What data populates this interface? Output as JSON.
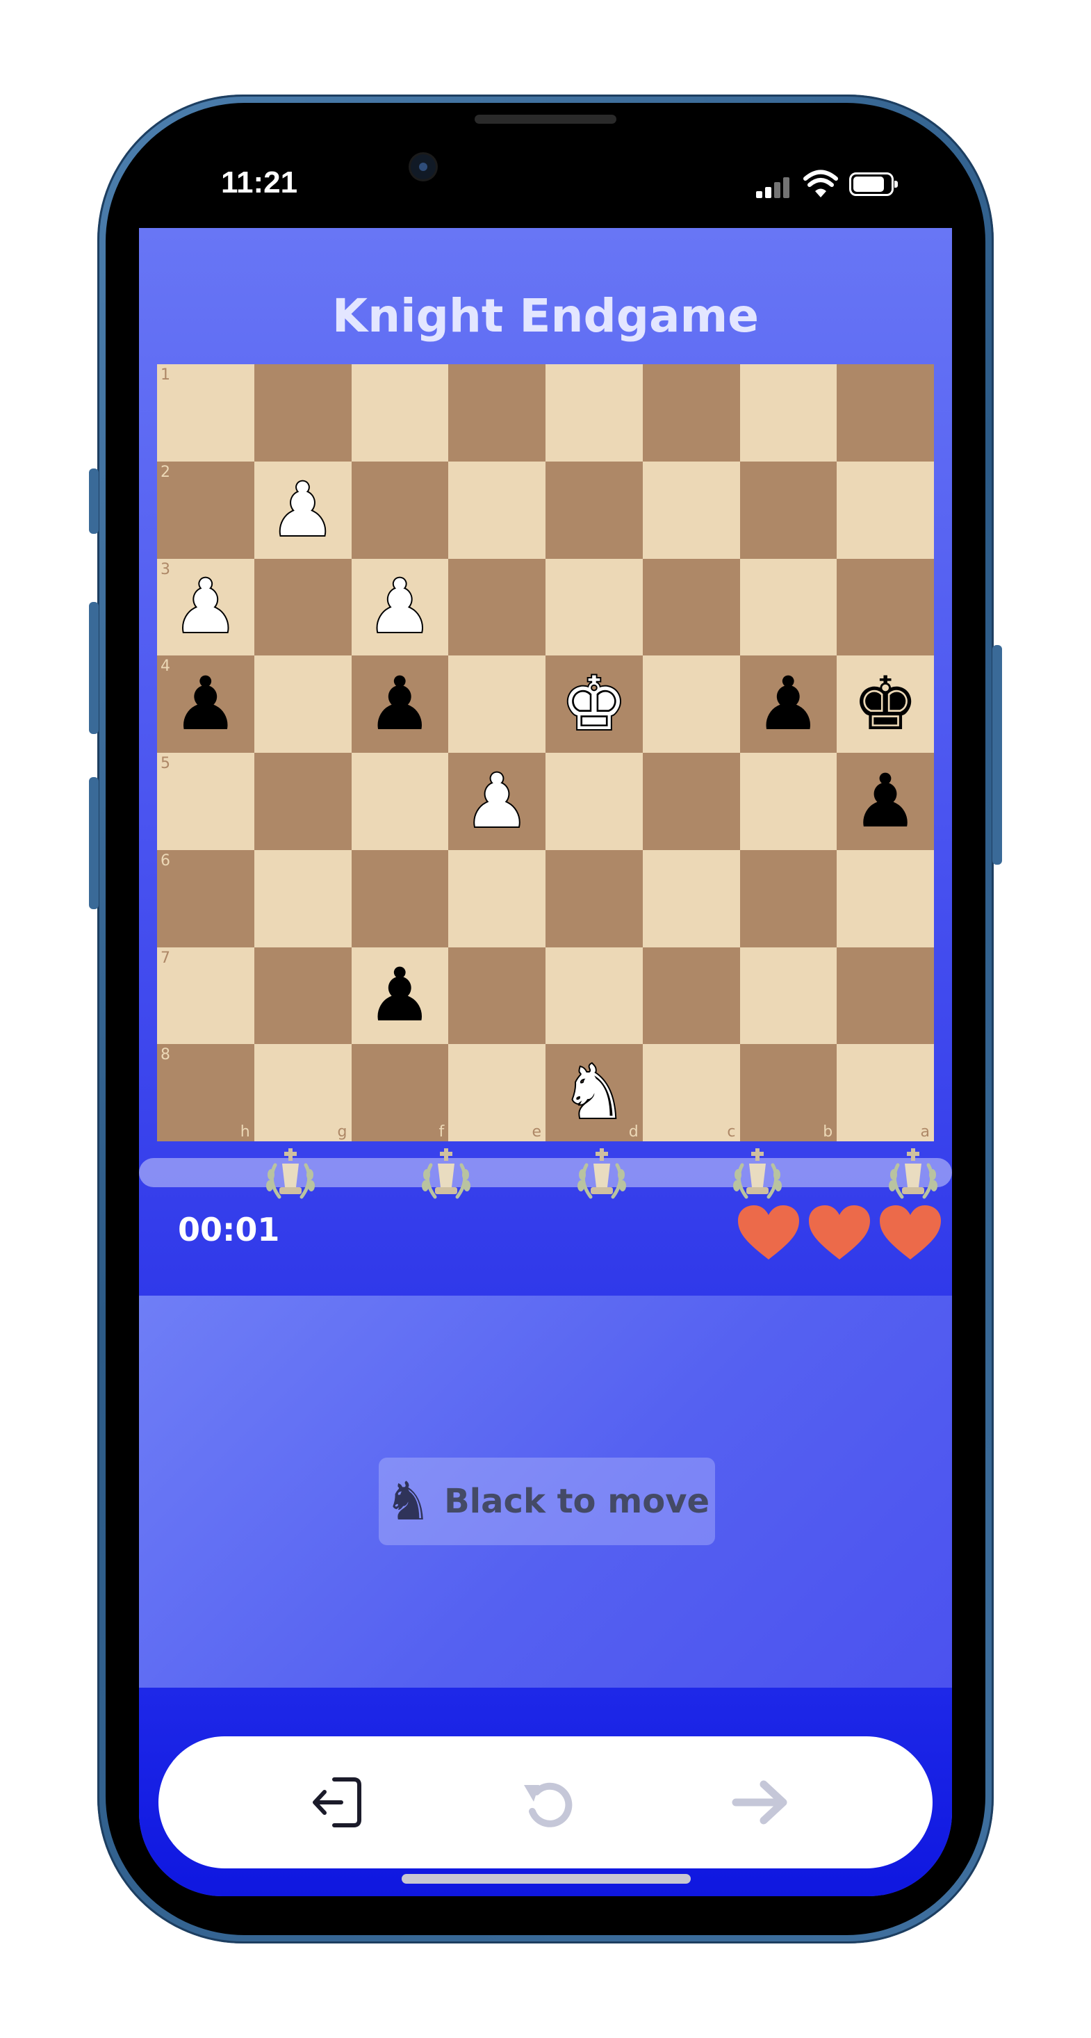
{
  "status_bar": {
    "time": "11:21"
  },
  "app": {
    "title": "Knight Endgame",
    "timer": "00:01",
    "lives": 3,
    "turn_piece": "♞",
    "turn_text": "Black to move"
  },
  "board": {
    "ranks": [
      "1",
      "2",
      "3",
      "4",
      "5",
      "6",
      "7",
      "8"
    ],
    "files": [
      "h",
      "g",
      "f",
      "e",
      "d",
      "c",
      "b",
      "a"
    ],
    "rows": [
      [
        "",
        "",
        "",
        "",
        "",
        "",
        "",
        ""
      ],
      [
        "",
        "wp",
        "",
        "",
        "",
        "",
        "",
        ""
      ],
      [
        "wp",
        "",
        "wp",
        "",
        "",
        "",
        "",
        ""
      ],
      [
        "bp",
        "",
        "bp",
        "",
        "wk",
        "",
        "bp",
        "bk"
      ],
      [
        "",
        "",
        "",
        "wp",
        "",
        "",
        "",
        "bp"
      ],
      [
        "",
        "",
        "",
        "",
        "",
        "",
        "",
        ""
      ],
      [
        "",
        "",
        "bp",
        "",
        "",
        "",
        "",
        ""
      ],
      [
        "",
        "",
        "",
        "",
        "wn",
        "",
        "",
        ""
      ]
    ],
    "glyphs": {
      "p": "♟",
      "k": "♚",
      "n": "♞"
    }
  },
  "colors": {
    "light_square": "#ecd8b6",
    "dark_square": "#ae8867",
    "heart": "#ec6a4a",
    "accent": "#4a54f0"
  },
  "icons": {
    "milestones": "king-laurel-icon",
    "exit": "exit-icon",
    "undo": "undo-icon",
    "next": "arrow-right-icon"
  }
}
